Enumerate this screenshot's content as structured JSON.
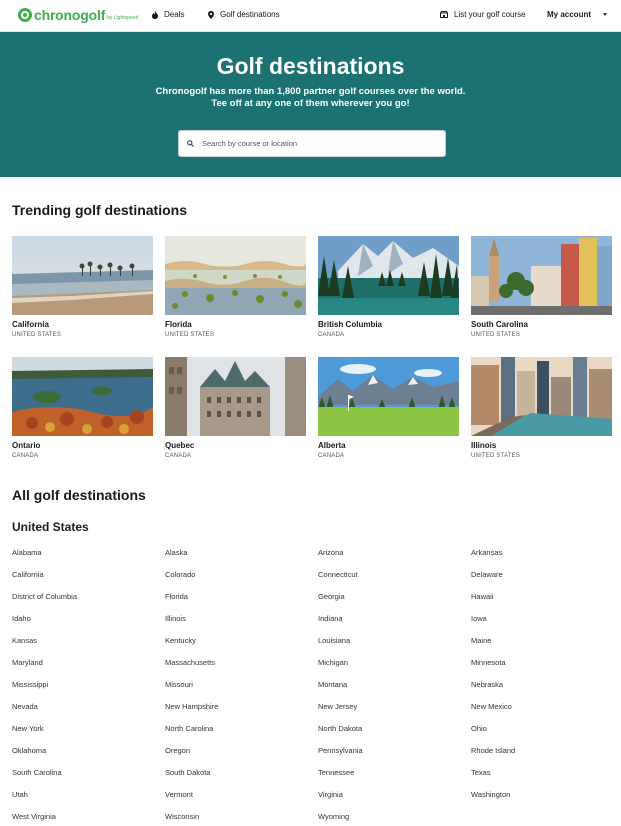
{
  "nav": {
    "logo_text": "chronogolf",
    "logo_sub": "by Lightspeed",
    "deals": "Deals",
    "golf_destinations": "Golf destinations",
    "list_course": "List your golf course",
    "my_account": "My account"
  },
  "hero": {
    "title": "Golf destinations",
    "subtitle_line1": "Chronogolf has more than 1,800 partner golf courses over the world.",
    "subtitle_line2": "Tee off at any one of them wherever you go!",
    "search_placeholder": "Search by course or location"
  },
  "trending": {
    "heading": "Trending golf destinations",
    "cards": [
      {
        "name": "California",
        "country": "UNITED STATES"
      },
      {
        "name": "Florida",
        "country": "UNITED STATES"
      },
      {
        "name": "British Columbia",
        "country": "CANADA"
      },
      {
        "name": "South Carolina",
        "country": "UNITED STATES"
      },
      {
        "name": "Ontario",
        "country": "CANADA"
      },
      {
        "name": "Quebec",
        "country": "CANADA"
      },
      {
        "name": "Alberta",
        "country": "CANADA"
      },
      {
        "name": "Illinois",
        "country": "UNITED STATES"
      }
    ]
  },
  "all": {
    "heading": "All golf destinations",
    "country": "United States",
    "states": [
      "Alabama",
      "Alaska",
      "Arizona",
      "Arkansas",
      "California",
      "Colorado",
      "Connecticut",
      "Delaware",
      "District of Columbia",
      "Florida",
      "Georgia",
      "Hawaii",
      "Idaho",
      "Illinois",
      "Indiana",
      "Iowa",
      "Kansas",
      "Kentucky",
      "Louisiana",
      "Maine",
      "Maryland",
      "Massachusetts",
      "Michigan",
      "Minnesota",
      "Mississippi",
      "Missouri",
      "Montana",
      "Nebraska",
      "Nevada",
      "New Hampshire",
      "New Jersey",
      "New Mexico",
      "New York",
      "North Carolina",
      "North Dakota",
      "Ohio",
      "Oklahoma",
      "Oregon",
      "Pennsylvania",
      "Rhode Island",
      "South Carolina",
      "South Dakota",
      "Tennessee",
      "Texas",
      "Utah",
      "Vermont",
      "Virginia",
      "Washington",
      "West Virginia",
      "Wisconsin",
      "Wyoming"
    ]
  },
  "colors": {
    "brand_green": "#3fb04b",
    "hero_teal": "#1c7272"
  }
}
